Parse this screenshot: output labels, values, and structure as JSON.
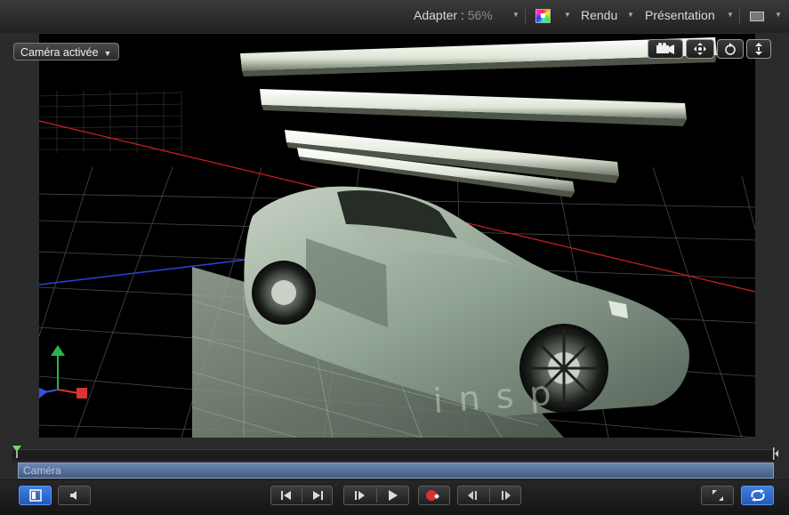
{
  "toolbar": {
    "fit_label": "Adapter :",
    "fit_value": "56%",
    "render_label": "Rendu",
    "presentation_label": "Présentation"
  },
  "canvas": {
    "camera_menu_label": "Caméra activée",
    "overlay_text": "insp"
  },
  "timeline": {
    "camera_track_label": "Caméra"
  },
  "colors": {
    "track_blue": "#5a74a0",
    "active_button_blue": "#2f6fd0",
    "record_red": "#d83030"
  }
}
